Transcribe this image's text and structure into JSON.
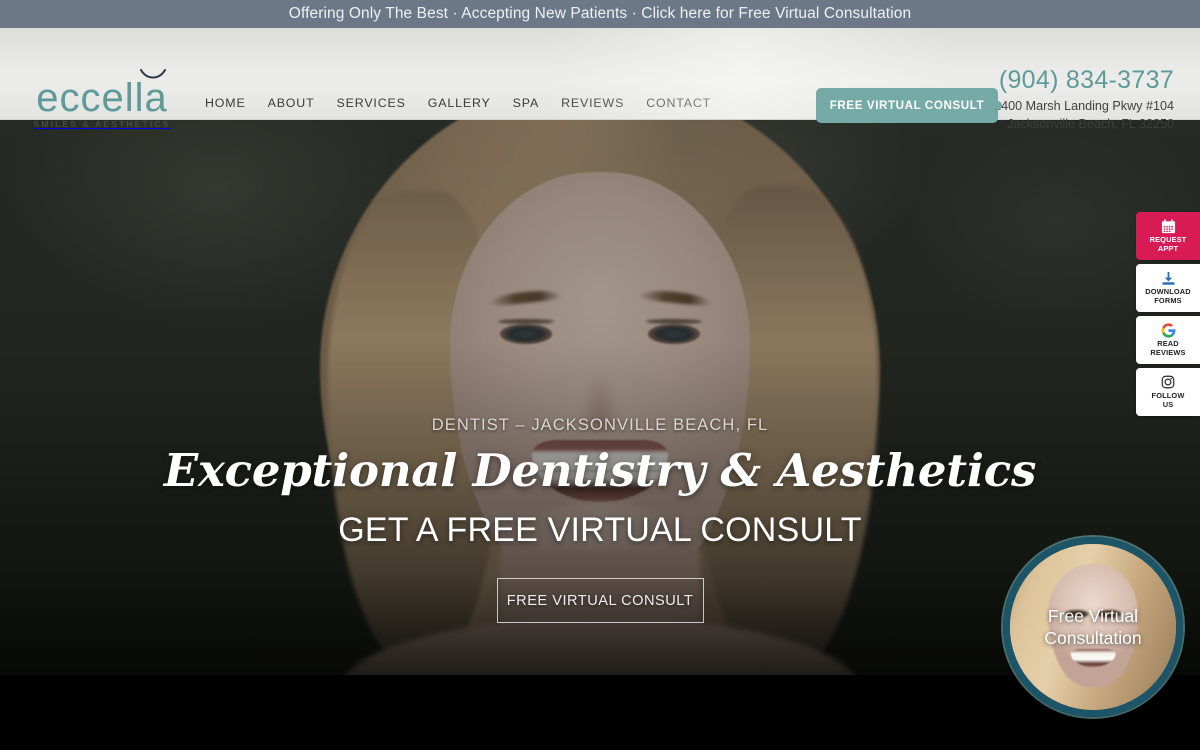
{
  "announcement": {
    "text": "Offering Only The Best · Accepting New Patients · Click here for Free Virtual Consultation",
    "background": "#6c7787"
  },
  "header": {
    "logo": {
      "name": "eccella",
      "tagline": "SMILES & AESTHETICS",
      "color": "#5e9a99",
      "smile_icon": "smile-curve-icon"
    },
    "nav": [
      {
        "label": "HOME"
      },
      {
        "label": "ABOUT"
      },
      {
        "label": "SERVICES"
      },
      {
        "label": "GALLERY"
      },
      {
        "label": "SPA"
      },
      {
        "label": "REVIEWS"
      },
      {
        "label": "CONTACT"
      }
    ],
    "cta_button": {
      "label": "FREE VIRTUAL CONSULT",
      "color": "#76aaa6"
    },
    "contact": {
      "phone": "(904) 834-3737",
      "phone_color": "#5e9a99",
      "address_line1": "1400 Marsh Landing Pkwy #104",
      "address_line2": "Jacksonville Beach, FL 32250"
    }
  },
  "hero": {
    "eyebrow": "DENTIST – JACKSONVILLE BEACH, FL",
    "title": "Exceptional Dentistry & Aesthetics",
    "subtitle": "GET A FREE VIRTUAL CONSULT",
    "button_label": "FREE VIRTUAL CONSULT"
  },
  "side_widgets": [
    {
      "line1": "REQUEST",
      "line2": "APPT",
      "icon": "calendar-icon",
      "background": "#d81b55",
      "text_color": "#ffffff"
    },
    {
      "line1": "DOWNLOAD",
      "line2": "FORMS",
      "icon": "download-icon",
      "background": "#ffffff",
      "text_color": "#232323"
    },
    {
      "line1": "READ",
      "line2": "REVIEWS",
      "icon": "google-g-icon",
      "background": "#ffffff",
      "text_color": "#232323"
    },
    {
      "line1": "FOLLOW",
      "line2": "US",
      "icon": "instagram-icon",
      "background": "#ffffff",
      "text_color": "#232323"
    }
  ],
  "float_badge": {
    "line1": "Free Virtual",
    "line2": "Consultation",
    "ring_color": "#1d5568"
  }
}
